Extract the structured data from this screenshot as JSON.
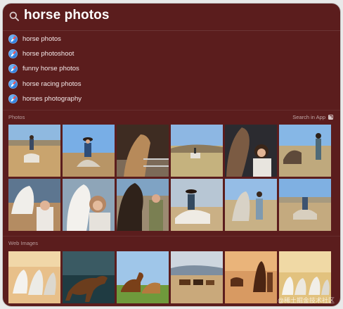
{
  "search": {
    "query": "horse photos"
  },
  "suggestions": [
    {
      "label": "horse photos"
    },
    {
      "label": "horse photoshoot"
    },
    {
      "label": "funny horse photos"
    },
    {
      "label": "horse racing photos"
    },
    {
      "label": "horses photography"
    }
  ],
  "photos": {
    "header": "Photos",
    "search_in_app": "Search in App"
  },
  "web_images": {
    "header": "Web Images"
  },
  "watermark": "@稀土掘金技术社区",
  "icons": {
    "search": "search-icon",
    "suggestion": "safari-compass-icon",
    "open": "open-in-app-icon"
  }
}
